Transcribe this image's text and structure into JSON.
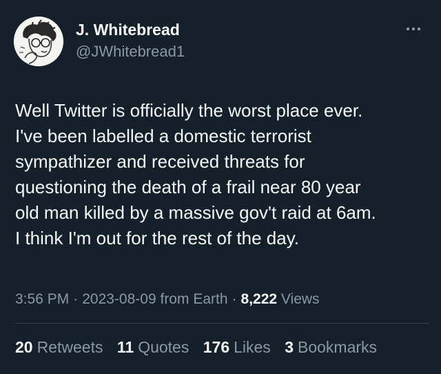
{
  "author": {
    "name": "J. Whitebread",
    "handle": "@JWhitebread1"
  },
  "tweet": {
    "lines": [
      "Well Twitter is officially the worst place ever.",
      "I've been labelled a domestic terrorist",
      "sympathizer and received threats for",
      "questioning the death of a frail near 80 year",
      "old man killed by a massive gov't raid at 6am.",
      "I think I'm out for the rest of the day."
    ]
  },
  "meta": {
    "time": "3:56 PM",
    "date": "2023-08-09",
    "source": "from Earth",
    "views_count": "8,222",
    "views_label": "Views"
  },
  "stats": {
    "retweets_count": "20",
    "retweets_label": "Retweets",
    "quotes_count": "11",
    "quotes_label": "Quotes",
    "likes_count": "176",
    "likes_label": "Likes",
    "bookmarks_count": "3",
    "bookmarks_label": "Bookmarks"
  },
  "colors": {
    "background": "#15202b",
    "text_primary": "#f7f9f9",
    "text_secondary": "#8b98a5",
    "divider": "#38444d"
  },
  "icons": {
    "more": "more-horizontal-icon"
  }
}
